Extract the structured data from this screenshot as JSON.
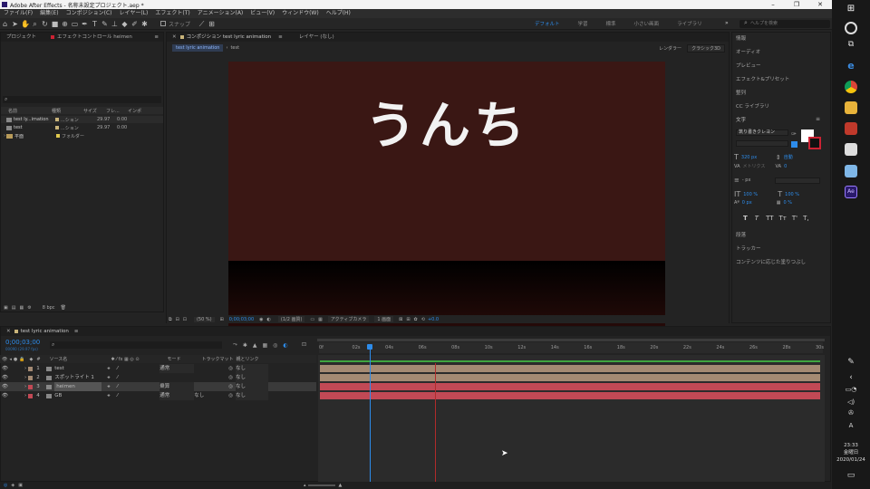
{
  "window": {
    "title": "Adobe After Effects - 名称未設定プロジェクト.aep *",
    "controls": [
      "–",
      "❐",
      "✕"
    ]
  },
  "menu": [
    "ファイル(F)",
    "編集(E)",
    "コンポジション(C)",
    "レイヤー(L)",
    "エフェクト(T)",
    "アニメーション(A)",
    "ビュー(V)",
    "ウィンドウ(W)",
    "ヘルプ(H)"
  ],
  "toolbar": {
    "snap": "スナップ",
    "workspaces": [
      "デフォルト",
      "学習",
      "標準",
      "小さい画面",
      "ライブラリ"
    ],
    "active_workspace": "デフォルト",
    "search_placeholder": "ヘルプを検索"
  },
  "project_panel": {
    "tabs": [
      "プロジェクト",
      "エフェクトコントロール heimen"
    ],
    "columns": [
      "名前",
      "種類",
      "サイズ",
      "フレ...",
      "インポ"
    ],
    "items": [
      {
        "name": "test ly...imation",
        "type": "...ション",
        "fps": "29.97",
        "extra": "0:00"
      },
      {
        "name": "test",
        "type": "...ション",
        "fps": "29.97",
        "extra": "0:00"
      },
      {
        "name": "平面",
        "type": "フォルダー",
        "fps": "",
        "extra": ""
      }
    ],
    "bpc": "8 bpc"
  },
  "comp_panel": {
    "tab": "コンポジション test lyric animation",
    "layer_tab": "レイヤー (なし)",
    "breadcrumbs": [
      "test lyric animation",
      "test"
    ],
    "renderer_label": "レンダラー",
    "renderer_value": "クラシック3D",
    "canvas_text": "うんち",
    "zoom": "(50 %)",
    "timecode": "0;00;03;00",
    "resolution": "(1/2 画質)",
    "camera": "アクティブカメラ",
    "views": "1 画面",
    "exposure": "+0.0"
  },
  "right_panel": {
    "items": [
      "情報",
      "オーディオ",
      "プレビュー",
      "エフェクト&プリセット",
      "整列",
      "CC ライブラリ"
    ],
    "text_section": "文字",
    "font": "筑り書きクレヨン",
    "font_size": "320 px",
    "leading": "自動",
    "tracking": "0",
    "kerning_label": "メトリクス",
    "stroke": "- px",
    "vscale": "100 %",
    "hscale": "100 %",
    "baseline": "0 px",
    "tsume": "0 %",
    "styles": [
      "T",
      "T",
      "TT",
      "Tт",
      "T'",
      "T,"
    ],
    "bottom_items": [
      "段落",
      "トラッカー",
      "コンテンツに応じた塗りつぶし"
    ]
  },
  "timeline": {
    "tab": "test lyric animation",
    "timecode": "0;00;03;00",
    "frame_info": "00090 (29.97 fps)",
    "col_source": "ソース名",
    "col_mode": "モード",
    "col_trkmat": "トラックマット",
    "col_parent": "親とリンク",
    "ruler": [
      "0f",
      "02s",
      "04s",
      "06s",
      "08s",
      "10s",
      "12s",
      "14s",
      "16s",
      "18s",
      "20s",
      "22s",
      "24s",
      "26s",
      "28s",
      "30s"
    ],
    "layers": [
      {
        "num": "1",
        "name": "test",
        "mode": "通常",
        "trk": "",
        "parent": "なし",
        "color": "#a48a73"
      },
      {
        "num": "2",
        "name": "スポットライト 1",
        "mode": "",
        "trk": "",
        "parent": "なし",
        "color": "#a48a73"
      },
      {
        "num": "3",
        "name": "heimen",
        "mode": "乗算",
        "trk": "",
        "parent": "なし",
        "color": "#c24955"
      },
      {
        "num": "4",
        "name": "GB",
        "mode": "通常",
        "trk": "なし",
        "parent": "なし",
        "color": "#c24955"
      }
    ],
    "playhead_fraction": 0.1
  },
  "taskbar": {
    "time": "23:33",
    "day": "金曜日",
    "date": "2020/01/24",
    "lang": "A"
  }
}
